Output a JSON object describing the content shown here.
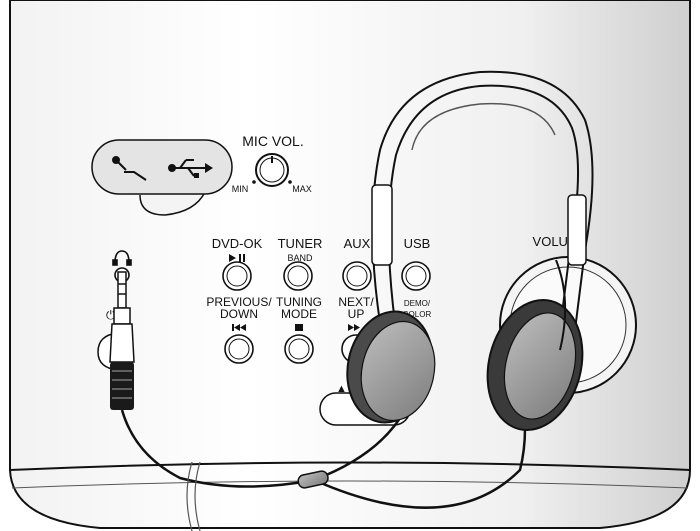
{
  "labels": {
    "mic_vol": "MIC VOL.",
    "min": "MIN",
    "max": "MAX",
    "dvd_ok": "DVD-OK",
    "tuner": "TUNER",
    "band": "BAND",
    "aux": "AUX",
    "usb": "USB",
    "previous": "PREVIOUS/",
    "down": "DOWN",
    "tuning": "TUNING",
    "mode": "MODE",
    "next": "NEXT/",
    "up": "UP",
    "demo": "DEMO/",
    "color": "COLOR",
    "volume": "VOLUME",
    "eject": "▲ E"
  },
  "icons": [
    "microphone-icon",
    "usb-icon",
    "headphone-icon",
    "play-pause-icon",
    "skip-back-icon",
    "stop-icon",
    "skip-forward-icon",
    "eject-icon"
  ]
}
